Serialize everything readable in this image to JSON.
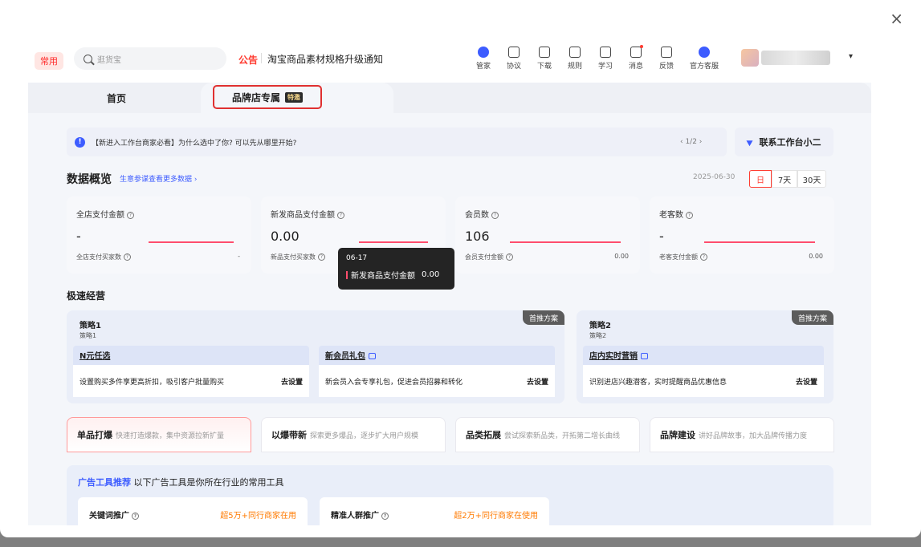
{
  "close_label": "×",
  "topbar": {
    "common_tag": "常用",
    "search_placeholder": "逛货宝",
    "notice_label": "公告",
    "notice_text": "淘宝商品素材规格升级通知",
    "tools": [
      {
        "label": "管家",
        "icon": "steward-icon"
      },
      {
        "label": "协议",
        "icon": "agreement-icon"
      },
      {
        "label": "下载",
        "icon": "download-icon"
      },
      {
        "label": "规则",
        "icon": "rules-icon"
      },
      {
        "label": "学习",
        "icon": "learn-icon"
      },
      {
        "label": "消息",
        "icon": "message-icon"
      },
      {
        "label": "反馈",
        "icon": "feedback-icon"
      },
      {
        "label": "官方客服",
        "icon": "support-icon"
      }
    ],
    "dropdown_icon": "▾"
  },
  "tabs": {
    "home": "首页",
    "brand": "品牌店专属",
    "brand_badge": "特邀"
  },
  "banner": {
    "text": "【新进入工作台商家必看】为什么选中了你? 可以先从哪里开始?",
    "pager": "‹ 1/2 ›",
    "contact": "联系工作台小二"
  },
  "overview": {
    "title": "数据概览",
    "link": "生意参谋查看更多数据 ›",
    "date": "2025-06-30",
    "ranges": [
      "日",
      "7天",
      "30天"
    ],
    "cards": [
      {
        "label": "全店支付金额",
        "value": "-",
        "sub_label": "全店支付买家数",
        "sub_value": "-"
      },
      {
        "label": "新发商品支付金额",
        "value": "0.00",
        "sub_label": "新品支付买家数",
        "sub_value": ""
      },
      {
        "label": "会员数",
        "value": "106",
        "sub_label": "会员支付金额",
        "sub_value": "0.00"
      },
      {
        "label": "老客数",
        "value": "-",
        "sub_label": "老客支付金额",
        "sub_value": "0.00"
      }
    ],
    "tooltip": {
      "date": "06-17",
      "series": "新发商品支付金额",
      "value": "0.00"
    }
  },
  "fast": {
    "title": "极速经营",
    "recommend": "首推方案",
    "strategies": [
      {
        "title": "策略1",
        "sub": "策略1",
        "items": [
          {
            "name": "N元任选",
            "desc": "设置购买多件享更高折扣，吸引客户批量购买",
            "action": "去设置"
          },
          {
            "name": "新会员礼包",
            "desc": "新会员入会专享礼包，促进会员招募和转化",
            "action": "去设置"
          }
        ]
      },
      {
        "title": "策略2",
        "sub": "策略2",
        "items": [
          {
            "name": "店内实时营销",
            "desc": "识别进店兴趣潜客，实时提醒商品优惠信息",
            "action": "去设置"
          }
        ]
      }
    ]
  },
  "modes": [
    {
      "name": "单品打爆",
      "desc": "快速打造爆款，集中资源拉新扩量"
    },
    {
      "name": "以爆带新",
      "desc": "探索更多爆品，逐步扩大用户规模"
    },
    {
      "name": "品类拓展",
      "desc": "尝试探索新品类，开拓第二增长曲线"
    },
    {
      "name": "品牌建设",
      "desc": "讲好品牌故事，加大品牌传播力度"
    }
  ],
  "ads": {
    "title_blue": "广告工具推荐",
    "title_rest": "以下广告工具是你所在行业的常用工具",
    "cards": [
      {
        "name": "关键词推广",
        "usage": "超5万+同行商家在用"
      },
      {
        "name": "精准人群推广",
        "usage": "超2万+同行商家在使用"
      }
    ]
  }
}
